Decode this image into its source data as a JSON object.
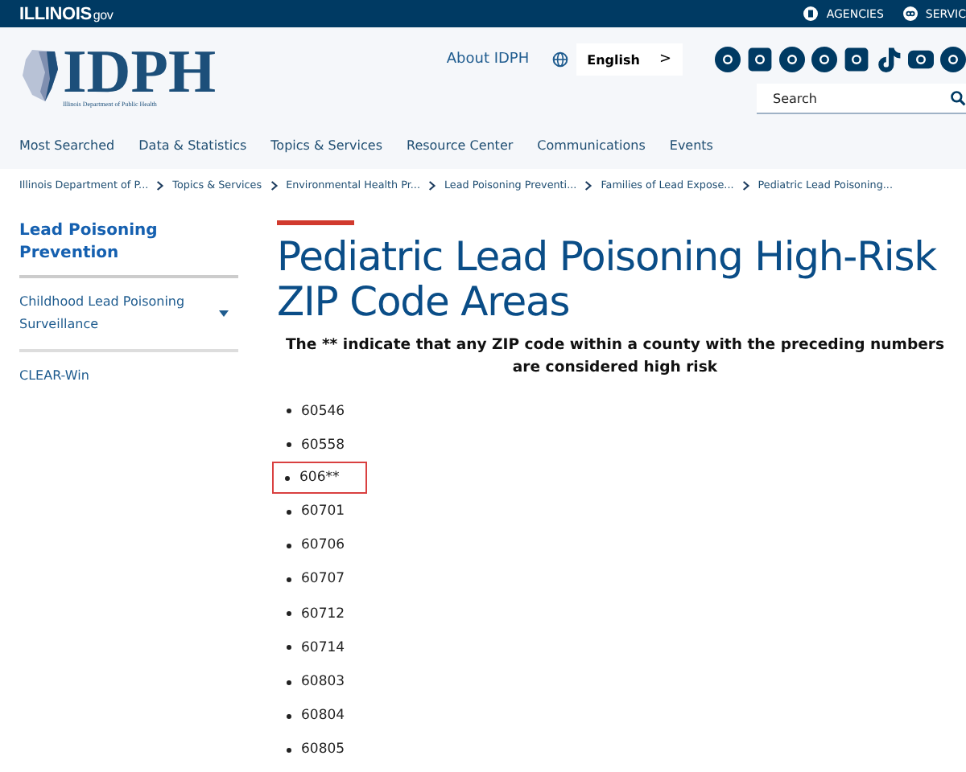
{
  "top_bar": {
    "logo": "ILLINOIS",
    "logo_suffix": "gov",
    "links": [
      {
        "label": "AGENCIES",
        "kind": "building"
      },
      {
        "label": "SERVIC",
        "kind": "services"
      }
    ]
  },
  "header": {
    "logo_text": "IDPH",
    "logo_subtitle": "Illinois Department of Public Health",
    "about_link": "About IDPH",
    "language": "English",
    "language_arrow": ">",
    "search": {
      "placeholder": "Search"
    }
  },
  "nav": [
    "Most Searched",
    "Data & Statistics",
    "Topics & Services",
    "Resource Center",
    "Communications",
    "Events"
  ],
  "breadcrumb": [
    "Illinois Department of P...",
    "Topics & Services",
    "Environmental Health Pr...",
    "Lead Poisoning Preventi...",
    "Families of Lead Expose...",
    "Pediatric Lead Poisoning..."
  ],
  "sidebar": {
    "title": "Lead Poisoning Prevention",
    "items": [
      {
        "label": "Childhood Lead Poisoning Surveillance",
        "expandable": true
      },
      {
        "label": "CLEAR-Win",
        "expandable": false
      }
    ]
  },
  "main": {
    "title": "Pediatric Lead Poisoning High-Risk ZIP Code Areas",
    "note": "The ** indicate that any ZIP code within a county with the preceding numbers are considered high risk",
    "zip_codes": [
      {
        "code": "60546",
        "highlighted": false
      },
      {
        "code": "60558",
        "highlighted": false
      },
      {
        "code": "606**",
        "highlighted": true
      },
      {
        "code": "60701",
        "highlighted": false
      },
      {
        "code": "60706",
        "highlighted": false
      },
      {
        "code": "60707",
        "highlighted": false
      },
      {
        "code": "60712",
        "highlighted": false
      },
      {
        "code": "60714",
        "highlighted": false
      },
      {
        "code": "60803",
        "highlighted": false
      },
      {
        "code": "60804",
        "highlighted": false
      },
      {
        "code": "60805",
        "highlighted": false
      }
    ]
  }
}
